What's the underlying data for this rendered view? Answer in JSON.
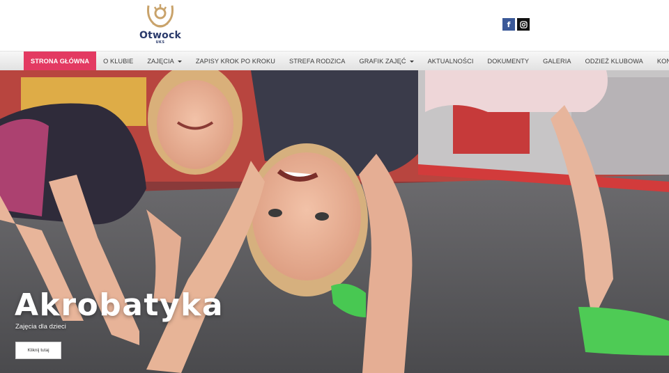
{
  "brand": {
    "name": "Otwock",
    "sub": "UKS"
  },
  "social": {
    "facebook_glyph": "f",
    "instagram_icon": "instagram-icon"
  },
  "nav": {
    "items": [
      {
        "label": "STRONA GŁÓWNA",
        "active": true
      },
      {
        "label": "O KLUBIE"
      },
      {
        "label": "ZAJĘCIA",
        "dropdown": true
      },
      {
        "label": "ZAPISY KROK PO KROKU"
      },
      {
        "label": "STREFA RODZICA"
      },
      {
        "label": "GRAFIK ZAJĘĆ",
        "dropdown": true
      },
      {
        "label": "AKTUALNOŚCI"
      },
      {
        "label": "DOKUMENTY"
      },
      {
        "label": "GALERIA"
      },
      {
        "label": "ODZIEŻ KLUBOWA"
      },
      {
        "label": "KONTAKT"
      }
    ]
  },
  "hero": {
    "title": "Akrobatyka",
    "subtitle": "Zajęcia dla dzieci",
    "button_label": "Kliknij tutaj"
  },
  "colors": {
    "accent": "#e33a62",
    "brand_navy": "#2a3a6b",
    "logo_gold": "#c9a36b",
    "facebook": "#3b5998"
  }
}
